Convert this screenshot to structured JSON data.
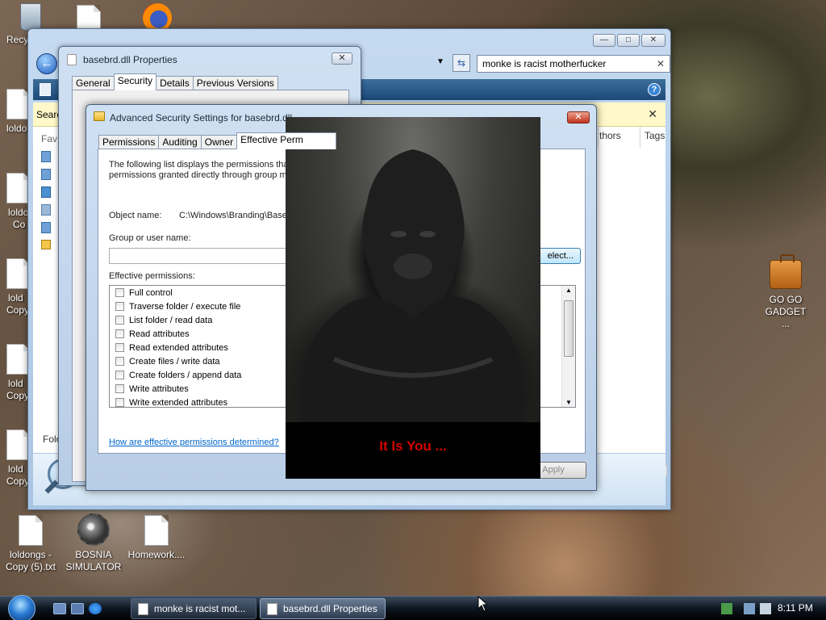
{
  "desktop": {
    "icons": [
      {
        "label": "Recy"
      },
      {
        "label": "loldo"
      },
      {
        "label": "loldo"
      },
      {
        "label": "Co"
      },
      {
        "label": "lold"
      },
      {
        "label": "Copy"
      },
      {
        "label": "lold"
      },
      {
        "label": "Copy"
      },
      {
        "label": "lold"
      },
      {
        "label": "Copy"
      },
      {
        "label": "loldongs - Copy (5).txt"
      },
      {
        "label": "BOSNIA SIMULATOR"
      },
      {
        "label": "Homework...."
      },
      {
        "label": "GO GO GADGET ..."
      }
    ]
  },
  "explorer": {
    "search_value": "monke is racist motherfucker",
    "info_bar_text": "Searc",
    "sidebar_label": "Fav",
    "columns": [
      "thors",
      "Tags"
    ],
    "details_label": "Folo",
    "clear_glyph": "✕",
    "help_glyph": "?",
    "close_glyph": "✕",
    "minimize_glyph": "—",
    "maximize_glyph": "□"
  },
  "properties": {
    "title": "basebrd.dll Properties",
    "tabs": [
      "General",
      "Security",
      "Details",
      "Previous Versions"
    ],
    "close_glyph": "✕"
  },
  "advanced": {
    "title": "Advanced Security Settings for basebrd.dll",
    "tabs": [
      "Permissions",
      "Auditing",
      "Owner",
      "Effective Perm"
    ],
    "description_line1": "The following list displays the permissions that w",
    "description_line2": "permissions granted directly through group mem",
    "object_name_label": "Object name:",
    "object_name_value": "C:\\Windows\\Branding\\Base",
    "group_label": "Group or user name:",
    "select_button": "elect...",
    "effective_label": "Effective permissions:",
    "permissions": [
      "Full control",
      "Traverse folder / execute file",
      "List folder / read data",
      "Read attributes",
      "Read extended attributes",
      "Create files / write data",
      "Create folders / append data",
      "Write attributes",
      "Write extended attributes"
    ],
    "link_text": "How are effective permissions determined?",
    "apply_button": "Apply",
    "close_glyph": "✕"
  },
  "popup": {
    "caption": "It Is You ..."
  },
  "taskbar": {
    "buttons": [
      {
        "label": "monke is racist mot..."
      },
      {
        "label": "basebrd.dll Properties"
      }
    ],
    "clock": "8:11 PM"
  },
  "colors": {
    "caption_red": "#d40000",
    "link_blue": "#0066cc"
  }
}
